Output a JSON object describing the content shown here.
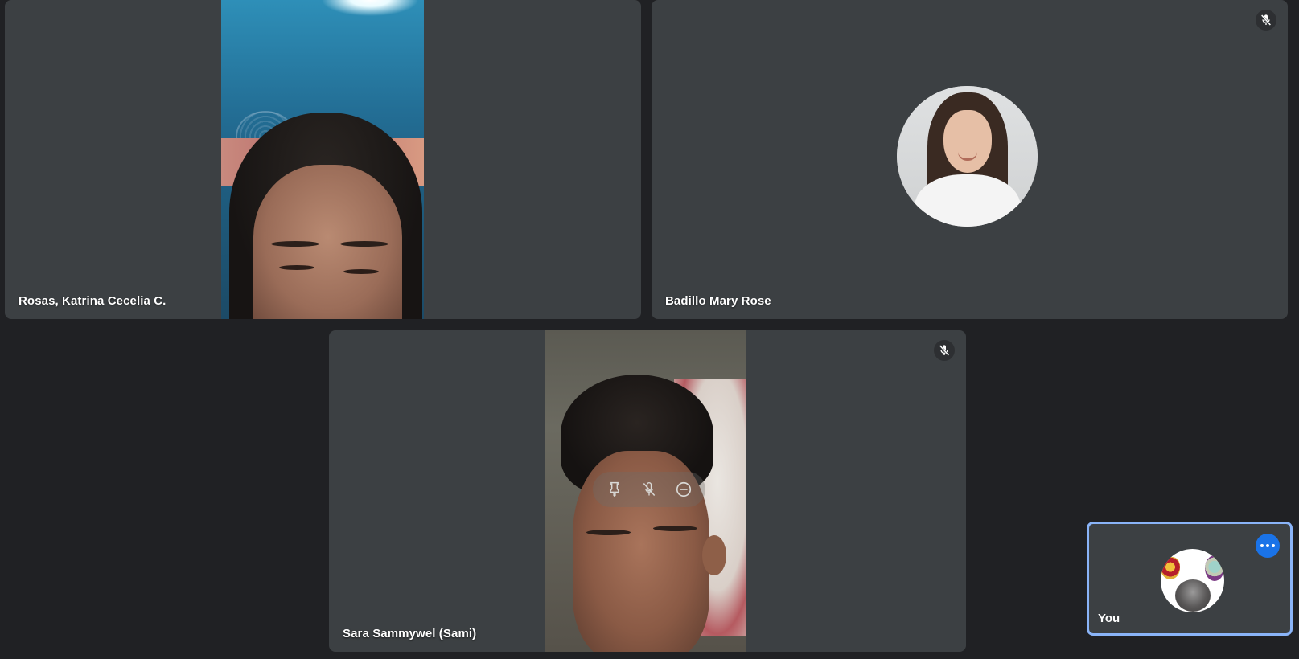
{
  "participants": [
    {
      "name": "Rosas, Katrina Cecelia C.",
      "camera": "on",
      "muted": false
    },
    {
      "name": "Badillo Mary Rose",
      "camera": "off",
      "muted": true
    },
    {
      "name": "Sara Sammywel (Sami)",
      "camera": "on",
      "muted": true
    }
  ],
  "self_view": {
    "name": "You",
    "camera": "off",
    "more_options_icon": "more-horizontal-icon"
  },
  "hover_controls": {
    "icons": [
      "pin-icon",
      "mic-off-icon",
      "remove-icon"
    ]
  },
  "colors": {
    "page_background": "#202124",
    "tile_background": "#3c4043",
    "self_border": "#8ab4f8",
    "accent": "#1a73e8",
    "text": "#ffffff"
  }
}
